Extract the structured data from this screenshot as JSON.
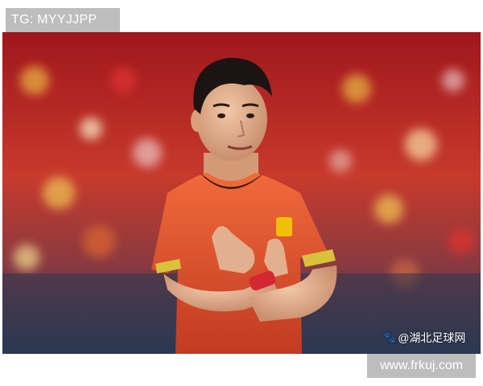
{
  "top_badge": {
    "text": "TG: MYYJJPP"
  },
  "photo": {
    "subject": "footballer-crossed-arms",
    "colors": {
      "jersey": "#e8512d",
      "crowd": "#b8262a",
      "trim": "#d7c23a"
    }
  },
  "watermark": {
    "icon": "paw-icon",
    "text": "@湖北足球网"
  },
  "bottom_badge": {
    "text": "www.frkuj.com"
  }
}
